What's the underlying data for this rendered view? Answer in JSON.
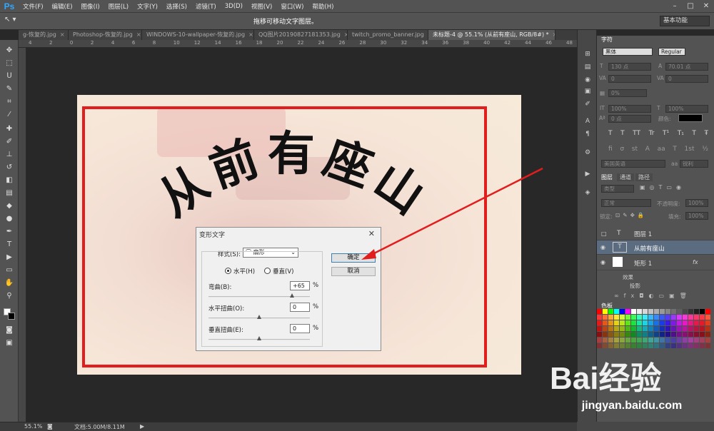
{
  "app": {
    "logo": "Ps",
    "menu": [
      "文件(F)",
      "编辑(E)",
      "图像(I)",
      "图层(L)",
      "文字(Y)",
      "选择(S)",
      "滤镜(T)",
      "3D(D)",
      "视图(V)",
      "窗口(W)",
      "帮助(H)"
    ],
    "window_controls": [
      "–",
      "□",
      "✕"
    ]
  },
  "options_bar": {
    "tool_glyph": "↖ ▾",
    "hint": "拖移可移动文字图层。",
    "workspace": "基本功能"
  },
  "tabs": [
    {
      "label": "g-恢复的.jpg",
      "active": false
    },
    {
      "label": "Photoshop-恢复的.jpg",
      "active": false
    },
    {
      "label": "WINDOWS-10-wallpaper-恢复的.jpg",
      "active": false
    },
    {
      "label": "QQ图片20190827181353.jpg",
      "active": false
    },
    {
      "label": "twitch_promo_banner.jpg",
      "active": false
    },
    {
      "label": "未标题-4 @ 55.1% (从前有座山, RGB/8#) *",
      "active": true
    }
  ],
  "ruler": {
    "top_ticks": [
      "4",
      "2",
      "0",
      "2",
      "4",
      "6",
      "8",
      "10",
      "12",
      "14",
      "16",
      "18",
      "20",
      "22",
      "24",
      "26",
      "28",
      "30",
      "32",
      "34",
      "36",
      "38",
      "40",
      "42",
      "44",
      "46",
      "48"
    ]
  },
  "canvas": {
    "warp_text": "从前有座山",
    "frame_color": "#e21d1d"
  },
  "dialog": {
    "title": "变形文字",
    "close": "✕",
    "style_label": "样式(S):",
    "style_value": "⌒ 扇形",
    "horizontal_label": "水平(H)",
    "vertical_label": "垂直(V)",
    "bend_label": "弯曲(B):",
    "bend_value": "+65",
    "hdistort_label": "水平扭曲(O):",
    "hdistort_value": "0",
    "vdistort_label": "垂直扭曲(E):",
    "vdistort_value": "0",
    "percent": "%",
    "ok": "确定",
    "cancel": "取消",
    "bend_level": 0.65,
    "hdistort_level": 0,
    "vdistort_level": 0
  },
  "char_panel": {
    "tab": "字符",
    "font_family": "黑体",
    "font_style": "Regular",
    "font_size": "130 点",
    "leading": "70.01 点",
    "kerning": "0",
    "tracking": "0",
    "scale_pct": "0%",
    "vscale": "100%",
    "hscale": "100%",
    "baseline": "0 点",
    "color_label": "颜色:",
    "style_buttons": [
      "T",
      "T",
      "TT",
      "Tr",
      "T¹",
      "T₁",
      "T",
      "Ŧ"
    ],
    "ot_buttons": [
      "ﬁ",
      "σ",
      "st",
      "A",
      "aa",
      "T",
      "1st",
      "½"
    ],
    "language": "美国英语",
    "aa_label": "aa",
    "aa_value": "锐利"
  },
  "layers_panel": {
    "tabs": [
      "图层",
      "通道",
      "路径"
    ],
    "kind": "类型",
    "blend": "正常",
    "opacity_label": "不透明度:",
    "opacity": "100%",
    "lock_label": "锁定:",
    "fill_label": "填充:",
    "fill": "100%",
    "layers": [
      {
        "name": "图层 1",
        "type": "T",
        "selected": false
      },
      {
        "name": "从前有座山",
        "type": "T",
        "selected": true
      },
      {
        "name": "矩形 1",
        "type": "shape",
        "selected": false,
        "fx": "fx"
      }
    ],
    "effects_label": "效果",
    "drop_shadow": "投影"
  },
  "swatches_panel": {
    "tab": "色板"
  },
  "status": {
    "zoom": "55.1%",
    "doc": "文档:5.00M/8.11M"
  },
  "watermark": {
    "brand": "Bai经验",
    "url": "jingyan.baidu.com"
  },
  "colors": {
    "accent_blue": "#31a8ff",
    "frame_red": "#e21d1d",
    "arrow_red": "#e21d1d"
  }
}
